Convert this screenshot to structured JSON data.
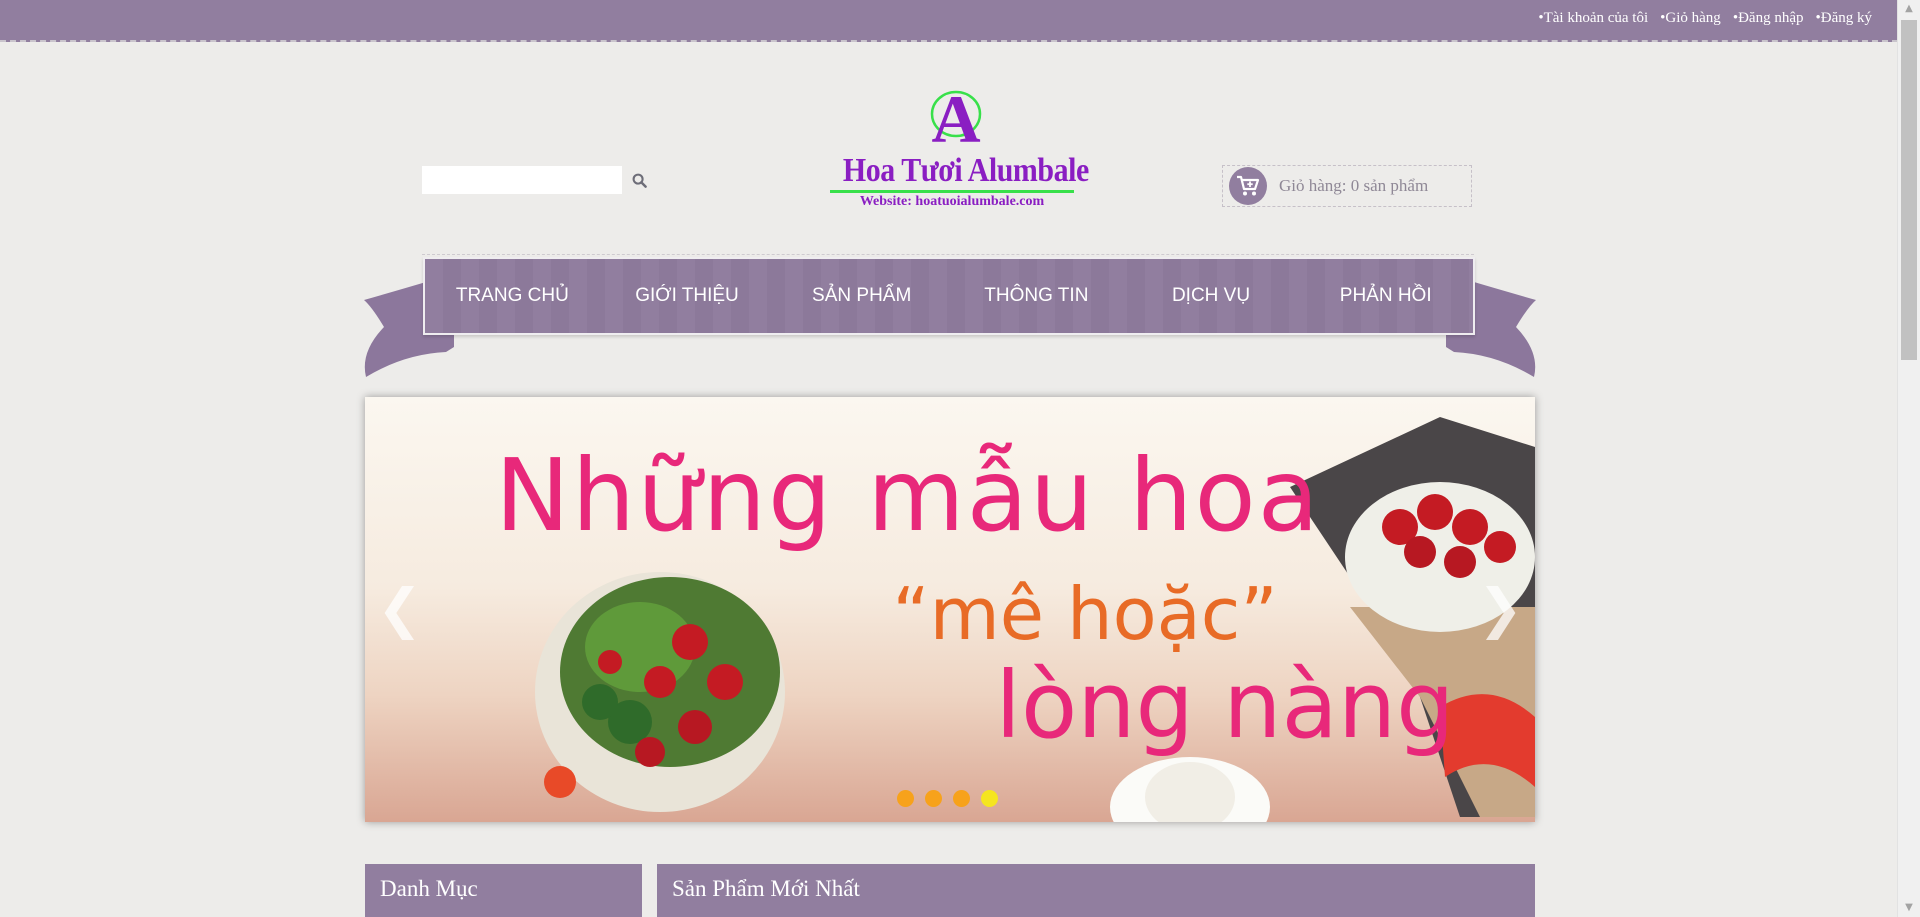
{
  "topbar": {
    "links": [
      "Tài khoản của tôi",
      "Giỏ hàng",
      "Đăng nhập",
      "Đăng ký"
    ]
  },
  "header": {
    "search": {
      "placeholder": "",
      "value": ""
    },
    "logo": {
      "letter": "A",
      "name": "Hoa Tươi Alumbale",
      "website": "Website: hoatuoialumbale.com"
    },
    "cart": {
      "label": "Giỏ hàng: 0 sản phẩm"
    }
  },
  "nav": {
    "items": [
      "TRANG CHỦ",
      "GIỚI THIỆU",
      "SẢN PHẨM",
      "THÔNG TIN",
      "DỊCH VỤ",
      "PHẢN HỒI"
    ]
  },
  "slider": {
    "lines": [
      "Những mẫu hoa",
      "“mê hoặc”",
      "lòng nàng"
    ],
    "active_dot": 4,
    "dot_count": 4
  },
  "sections": {
    "left_title": "Danh Mục",
    "right_title": "Sản Phẩm Mới Nhất"
  },
  "colors": {
    "accent": "#917e9f",
    "background": "#edecea",
    "logo": "#8a1ec2",
    "dot": "#f7a21b",
    "dot_active": "#f5e51f"
  }
}
